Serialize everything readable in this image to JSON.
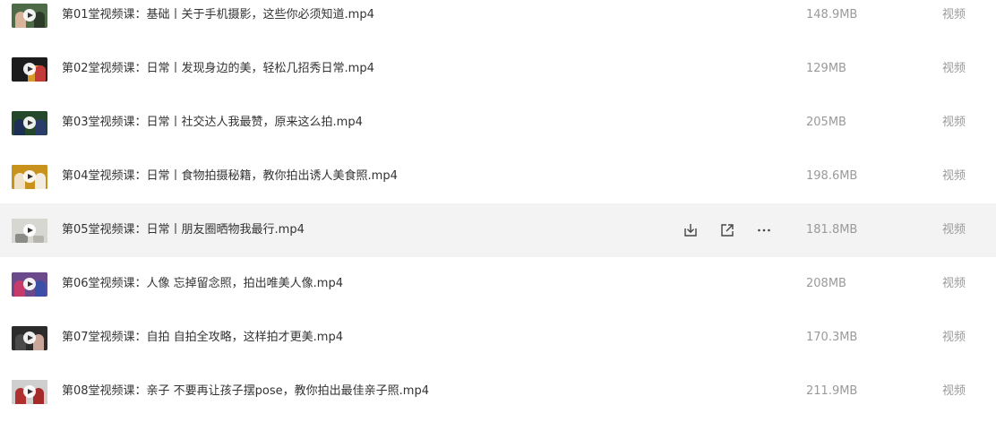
{
  "files": [
    {
      "name": "第01堂视频课：基础丨关于手机摄影，这些你必须知道.mp4",
      "size": "148.9MB",
      "type": "视频"
    },
    {
      "name": "第02堂视频课：日常丨发现身边的美，轻松几招秀日常.mp4",
      "size": "129MB",
      "type": "视频"
    },
    {
      "name": "第03堂视频课：日常丨社交达人我最赞，原来这么拍.mp4",
      "size": "205MB",
      "type": "视频"
    },
    {
      "name": "第04堂视频课：日常丨食物拍摄秘籍，教你拍出诱人美食照.mp4",
      "size": "198.6MB",
      "type": "视频"
    },
    {
      "name": "第05堂视频课：日常丨朋友圈晒物我最行.mp4",
      "size": "181.8MB",
      "type": "视频"
    },
    {
      "name": "第06堂视频课：人像  忘掉留念照，拍出唯美人像.mp4",
      "size": "208MB",
      "type": "视频"
    },
    {
      "name": "第07堂视频课：自拍  自拍全攻略，这样拍才更美.mp4",
      "size": "170.3MB",
      "type": "视频"
    },
    {
      "name": "第08堂视频课：亲子  不要再让孩子摆pose，教你拍出最佳亲子照.mp4",
      "size": "211.9MB",
      "type": "视频"
    }
  ],
  "hovered_row_actions": {
    "download_icon": "download-icon",
    "share_icon": "share-icon",
    "more_icon": "more-icon"
  },
  "colors": {
    "hover_background": "#f3f3f4",
    "filename_text": "#333333",
    "meta_text": "#9a9a9a"
  }
}
